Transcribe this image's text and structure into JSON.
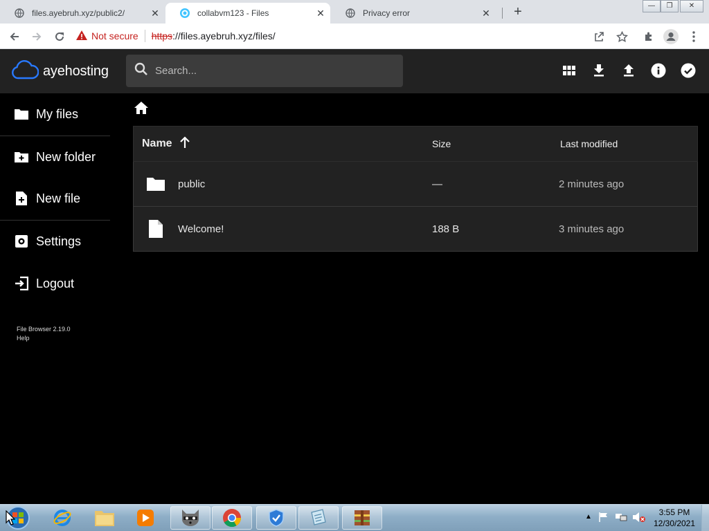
{
  "browser": {
    "tabs": [
      {
        "title": "files.ayebruh.xyz/public2/",
        "active": false
      },
      {
        "title": "collabvm123 - Files",
        "active": true
      },
      {
        "title": "Privacy error",
        "active": false
      }
    ],
    "security_label": "Not secure",
    "url_scheme": "https",
    "url_rest": "://files.ayebruh.xyz/files/",
    "icons": [
      "back-arrow-icon",
      "forward-arrow-icon",
      "reload-icon",
      "warning-icon",
      "share-icon",
      "star-icon",
      "extension-icon",
      "profile-icon",
      "menu-icon"
    ]
  },
  "app": {
    "brand": "ayehosting",
    "search_placeholder": "Search...",
    "header_icons": [
      "grid-view-icon",
      "download-icon",
      "upload-icon",
      "info-icon",
      "check-circle-icon"
    ],
    "accent_color": "#2979ff"
  },
  "sidebar": {
    "items": [
      {
        "label": "My files",
        "icon": "folder-icon"
      },
      {
        "label": "New folder",
        "icon": "create-folder-icon"
      },
      {
        "label": "New file",
        "icon": "note-add-icon"
      },
      {
        "label": "Settings",
        "icon": "settings-icon"
      },
      {
        "label": "Logout",
        "icon": "exit-icon"
      }
    ],
    "version": "File Browser 2.19.0",
    "help": "Help"
  },
  "listing": {
    "columns": {
      "name": "Name",
      "size": "Size",
      "modified": "Last modified"
    },
    "sort": "name-ascending",
    "rows": [
      {
        "name": "public",
        "size": "—",
        "modified": "2 minutes ago",
        "type": "folder"
      },
      {
        "name": "Welcome!",
        "size": "188 B",
        "modified": "3 minutes ago",
        "type": "file"
      }
    ]
  },
  "taskbar": {
    "time": "3:55 PM",
    "date": "12/30/2021",
    "apps": [
      "start-orb",
      "internet-explorer",
      "file-explorer",
      "media-player",
      "raccoon-app",
      "chrome",
      "security-app",
      "notepad-app",
      "winrar-app"
    ]
  }
}
